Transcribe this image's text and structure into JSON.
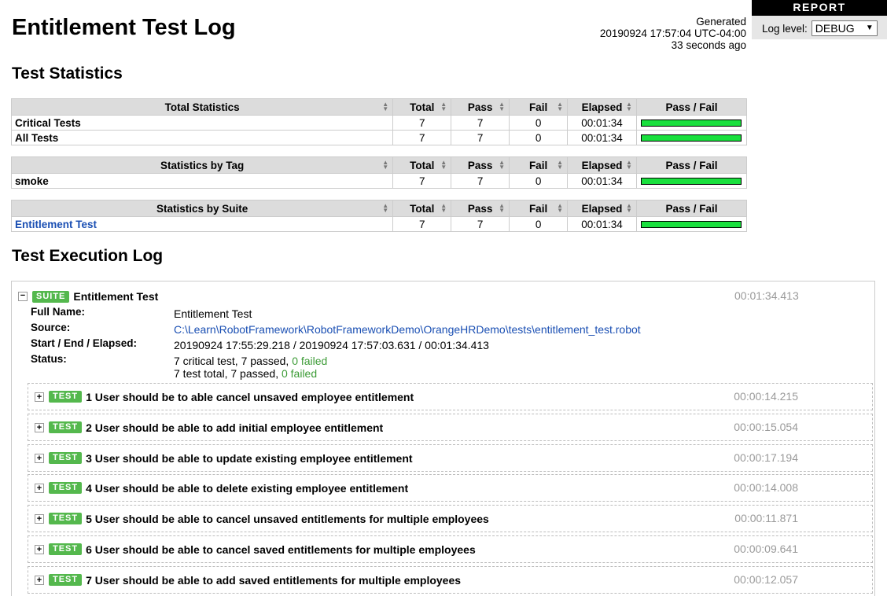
{
  "title": "Entitlement Test Log",
  "generated": {
    "label": "Generated",
    "datetime": "20190924 17:57:04 UTC-04:00",
    "ago": "33 seconds ago"
  },
  "report_panel": {
    "report_label": "REPORT",
    "log_level_label": "Log level:",
    "log_level_value": "DEBUG"
  },
  "sections": {
    "statistics": "Test Statistics",
    "execution": "Test Execution Log"
  },
  "stat_columns": {
    "total": "Total",
    "pass": "Pass",
    "fail": "Fail",
    "elapsed": "Elapsed",
    "graph": "Pass / Fail"
  },
  "stat_tables": [
    {
      "header": "Total Statistics",
      "rows": [
        {
          "name": "Critical Tests",
          "total": "7",
          "pass": "7",
          "fail": "0",
          "elapsed": "00:01:34",
          "pass_fraction": 1.0
        },
        {
          "name": "All Tests",
          "total": "7",
          "pass": "7",
          "fail": "0",
          "elapsed": "00:01:34",
          "pass_fraction": 1.0
        }
      ]
    },
    {
      "header": "Statistics by Tag",
      "rows": [
        {
          "name": "smoke",
          "total": "7",
          "pass": "7",
          "fail": "0",
          "elapsed": "00:01:34",
          "pass_fraction": 1.0
        }
      ]
    },
    {
      "header": "Statistics by Suite",
      "rows": [
        {
          "name": "Entitlement Test",
          "total": "7",
          "pass": "7",
          "fail": "0",
          "elapsed": "00:01:34",
          "pass_fraction": 1.0
        }
      ]
    }
  ],
  "suite": {
    "badge": "SUITE",
    "name": "Entitlement Test",
    "elapsed": "00:01:34.413",
    "full_name_label": "Full Name:",
    "full_name": "Entitlement Test",
    "source_label": "Source:",
    "source": "C:\\Learn\\RobotFramework\\RobotFrameworkDemo\\OrangeHRDemo\\tests\\entitlement_test.robot",
    "times_label": "Start / End / Elapsed:",
    "times": "20190924 17:55:29.218 / 20190924 17:57:03.631 / 00:01:34.413",
    "status_label": "Status:",
    "status_critical": "7 critical test, 7 passed,",
    "status_critical_failed": "0 failed",
    "status_total": "7 test total, 7 passed,",
    "status_total_failed": "0 failed"
  },
  "tests": [
    {
      "badge": "TEST",
      "name": "1 User should be to able cancel unsaved employee entitlement",
      "elapsed": "00:00:14.215"
    },
    {
      "badge": "TEST",
      "name": "2 User should be able to add initial employee entitlement",
      "elapsed": "00:00:15.054"
    },
    {
      "badge": "TEST",
      "name": "3 User should be able to update existing employee entitlement",
      "elapsed": "00:00:17.194"
    },
    {
      "badge": "TEST",
      "name": "4 User should be able to delete existing employee entitlement",
      "elapsed": "00:00:14.008"
    },
    {
      "badge": "TEST",
      "name": "5 User should be able to cancel unsaved entitlements for multiple employees",
      "elapsed": "00:00:11.871"
    },
    {
      "badge": "TEST",
      "name": "6 User should be able to cancel saved entitlements for multiple employees",
      "elapsed": "00:00:09.641"
    },
    {
      "badge": "TEST",
      "name": "7 User should be able to add saved entitlements for multiple employees",
      "elapsed": "00:00:12.057"
    }
  ],
  "colors": {
    "pass": "#19e03d",
    "fail": "#ce3e01",
    "badge": "#54b84d",
    "link": "#1a4fb3",
    "header_bg": "#dcdcdc"
  },
  "icons": {
    "toggle_expanded": "−",
    "toggle_collapsed": "+",
    "sort": "sort-arrows-icon",
    "dropdown": "▼"
  }
}
